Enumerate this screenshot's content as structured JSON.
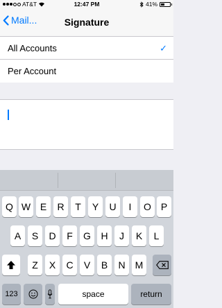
{
  "status": {
    "carrier": "AT&T",
    "time": "12:47 PM",
    "battery": "41%",
    "battery_level": 0.41
  },
  "nav": {
    "back_label": "Mail...",
    "title": "Signature"
  },
  "options": [
    {
      "label": "All Accounts",
      "selected": true
    },
    {
      "label": "Per Account",
      "selected": false
    }
  ],
  "checkmark": "✓",
  "signature": {
    "value": ""
  },
  "keyboard": {
    "row1": [
      "Q",
      "W",
      "E",
      "R",
      "T",
      "Y",
      "U",
      "I",
      "O",
      "P"
    ],
    "row2": [
      "A",
      "S",
      "D",
      "F",
      "G",
      "H",
      "J",
      "K",
      "L"
    ],
    "row3": [
      "Z",
      "X",
      "C",
      "V",
      "B",
      "N",
      "M"
    ],
    "numbers_label": "123",
    "space_label": "space",
    "return_label": "return",
    "icons": [
      "shift-icon",
      "backspace-icon",
      "emoji-icon",
      "microphone-icon"
    ]
  },
  "colors": {
    "accent": "#007aff"
  }
}
